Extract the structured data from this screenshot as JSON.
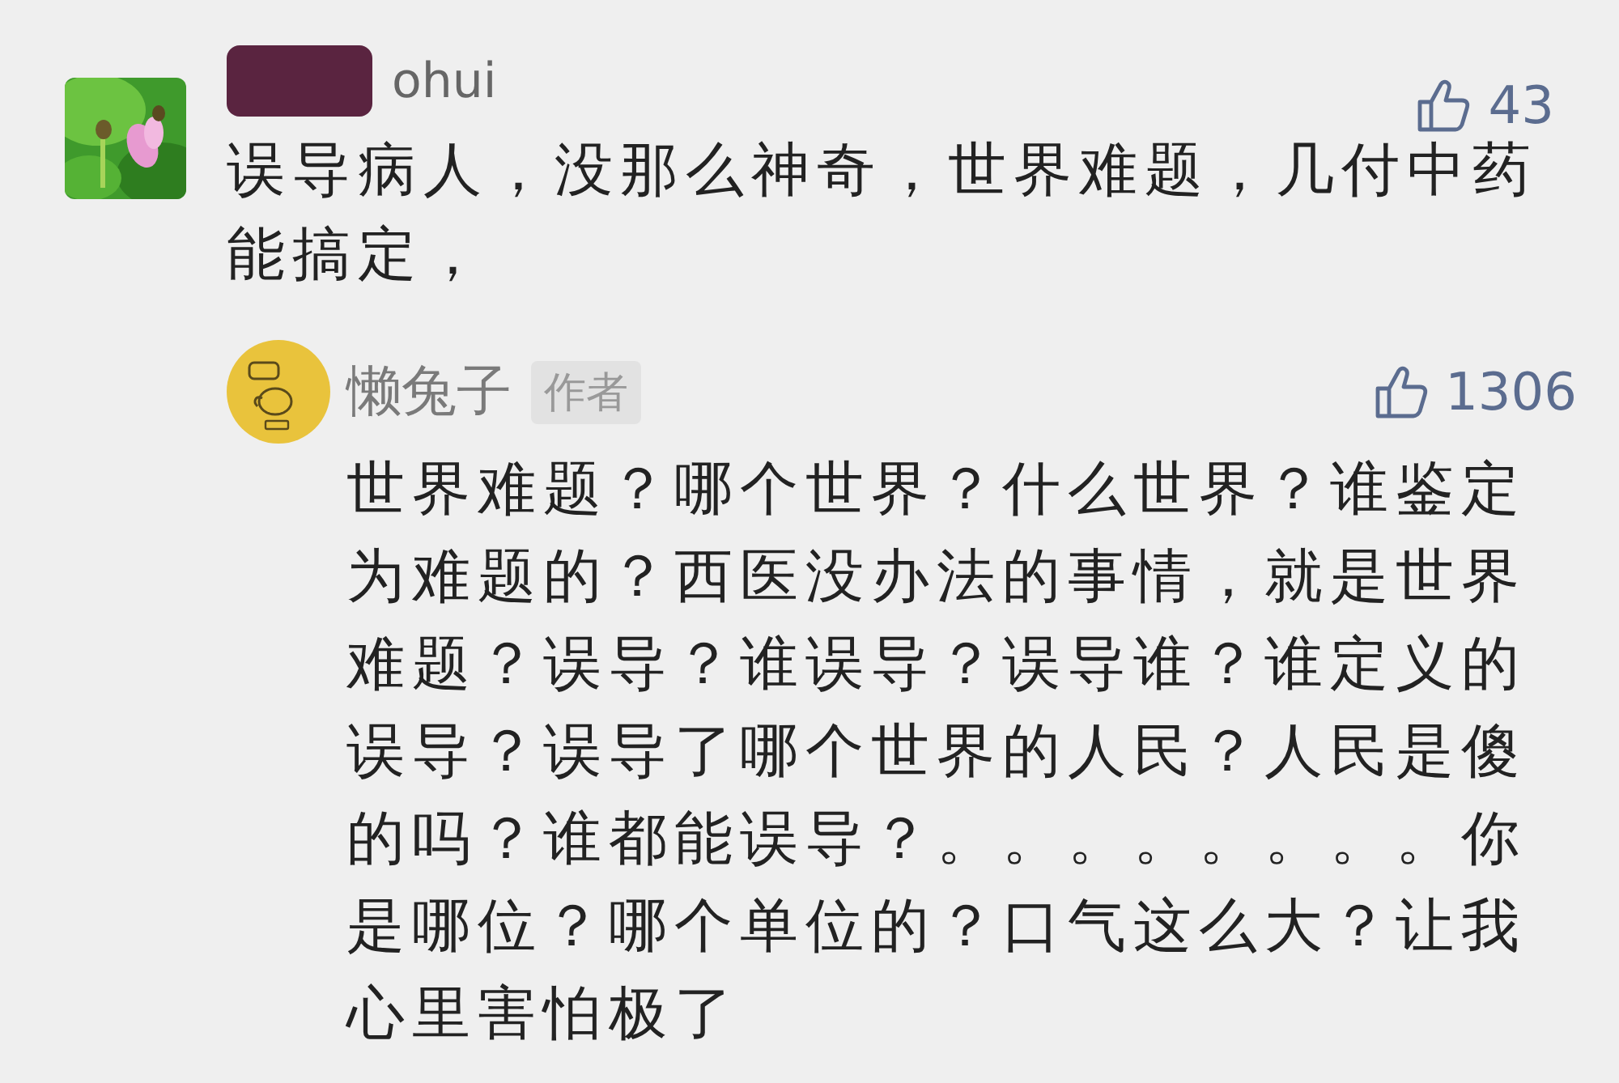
{
  "comment": {
    "username": "ohui",
    "username_redacted": true,
    "likes": "43",
    "text": "误导病人，没那么神奇，世界难题，几付中药能搞定，",
    "reply": {
      "username": "懒兔子",
      "badge": "作者",
      "likes": "1306",
      "text": "世界难题？哪个世界？什么世界？谁鉴定为难题的？西医没办法的事情，就是世界难题？误导？谁误导？误导谁？谁定义的误导？误导了哪个世界的人民？人民是傻的吗？谁都能误导？。。。。。。。。你是哪位？哪个单位的？口气这么大？让我心里害怕极了"
    }
  }
}
